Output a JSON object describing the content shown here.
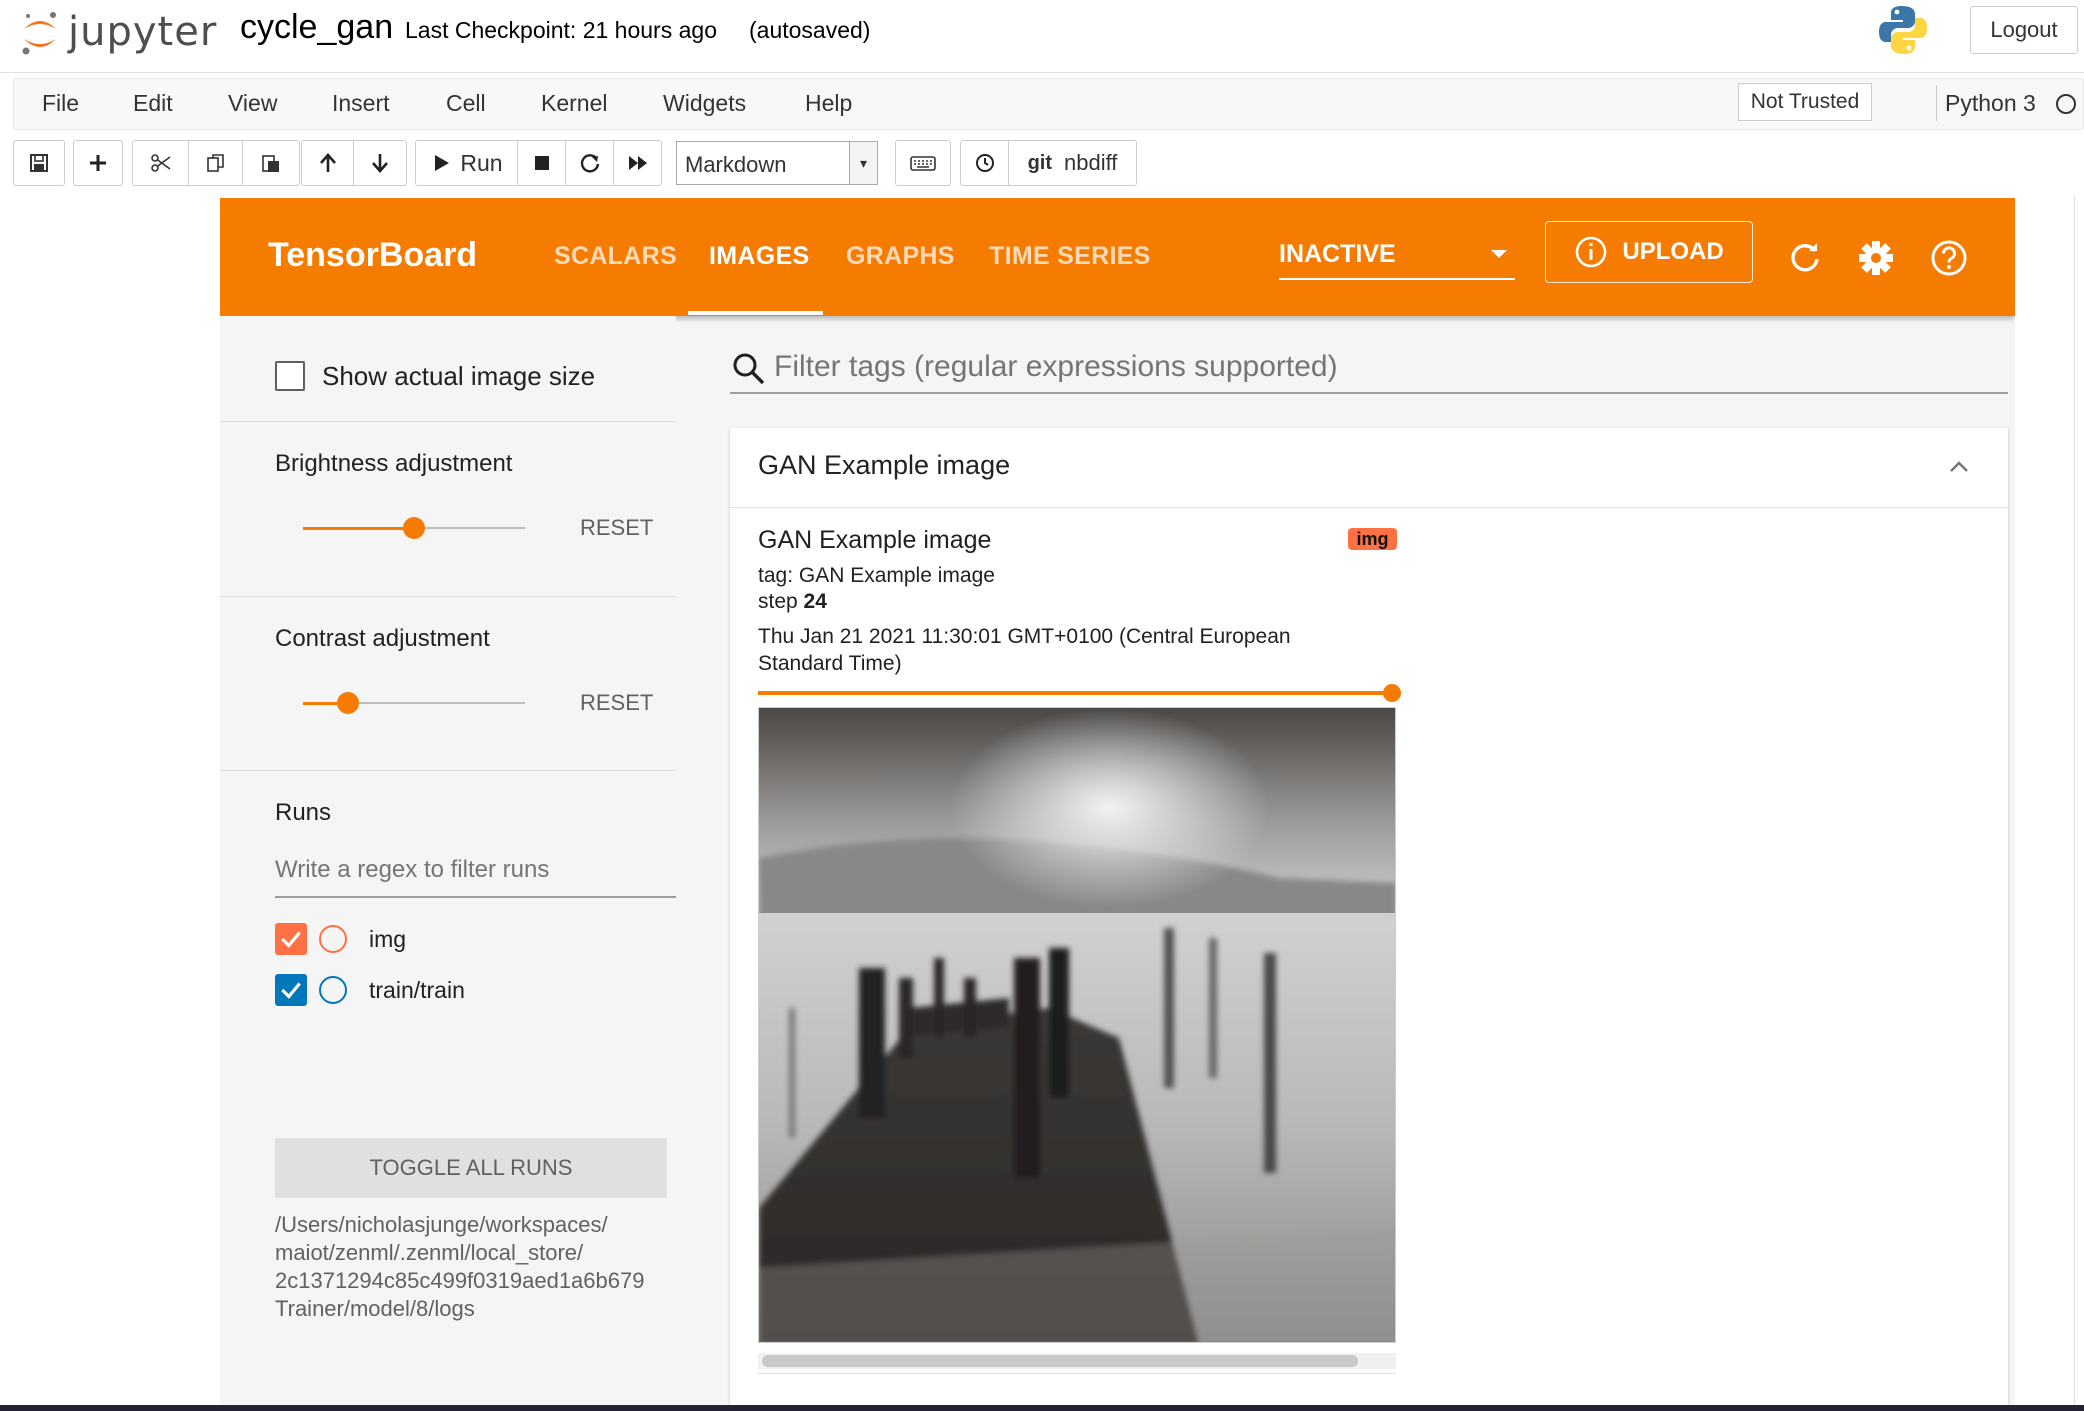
{
  "jupyter": {
    "logo_text": "jupyter",
    "notebook_name": "cycle_gan",
    "checkpoint": "Last Checkpoint: 21 hours ago",
    "autosave": "(autosaved)",
    "logout": "Logout",
    "menu": [
      "File",
      "Edit",
      "View",
      "Insert",
      "Cell",
      "Kernel",
      "Widgets",
      "Help"
    ],
    "trust": "Not Trusted",
    "kernel": "Python 3",
    "toolbar": {
      "run_label": "Run",
      "cell_type": "Markdown",
      "git_label": "git",
      "nbdiff_label": "nbdiff"
    }
  },
  "tensorboard": {
    "title": "TensorBoard",
    "tabs": [
      {
        "label": "SCALARS",
        "active": false
      },
      {
        "label": "IMAGES",
        "active": true
      },
      {
        "label": "GRAPHS",
        "active": false
      },
      {
        "label": "TIME SERIES",
        "active": false
      }
    ],
    "run_selector": "INACTIVE",
    "upload_label": "UPLOAD",
    "accent_color": "#f57c00",
    "sidebar": {
      "show_actual_size_label": "Show actual image size",
      "show_actual_size_checked": false,
      "brightness": {
        "label": "Brightness adjustment",
        "value_fraction": 0.5,
        "reset": "RESET"
      },
      "contrast": {
        "label": "Contrast adjustment",
        "value_fraction": 0.2,
        "reset": "RESET"
      },
      "runs_heading": "Runs",
      "runs_filter_placeholder": "Write a regex to filter runs",
      "runs": [
        {
          "name": "img",
          "checked": true,
          "color": "#ff7043"
        },
        {
          "name": "train/train",
          "checked": true,
          "color": "#0077bb"
        }
      ],
      "toggle_all": "TOGGLE ALL RUNS",
      "logdir": "/Users/nicholasjunge/workspaces/\nmaiot/zenml/.zenml/local_store/\n2c1371294c85c499f0319aed1a6b679\nTrainer/model/8/logs"
    },
    "main": {
      "filter_placeholder": "Filter tags (regular expressions supported)",
      "category_title": "GAN Example image",
      "image_card": {
        "title": "GAN Example image",
        "badge": "img",
        "tag": "tag: GAN Example image",
        "step_label": "step",
        "step_value": "24",
        "timestamp": "Thu Jan 21 2021 11:30:01 GMT+0100 (Central European Standard Time)",
        "step_slider_fraction": 1.0
      }
    }
  }
}
